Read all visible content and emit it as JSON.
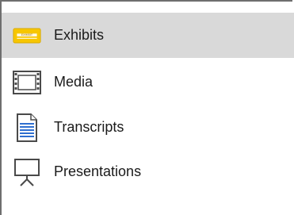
{
  "nav": {
    "selected_index": 0,
    "items": [
      {
        "label": "Exhibits",
        "icon": "exhibit-sticker-icon",
        "icon_text": "EXHIBIT",
        "icon_color": "#f7c600"
      },
      {
        "label": "Media",
        "icon": "film-strip-icon"
      },
      {
        "label": "Transcripts",
        "icon": "document-icon"
      },
      {
        "label": "Presentations",
        "icon": "presentation-easel-icon"
      }
    ]
  },
  "colors": {
    "selected_bg": "#d9d9d9",
    "border": "#6f6f6f",
    "icon_stroke": "#4a4a4a",
    "document_accent": "#2f6fd0"
  }
}
